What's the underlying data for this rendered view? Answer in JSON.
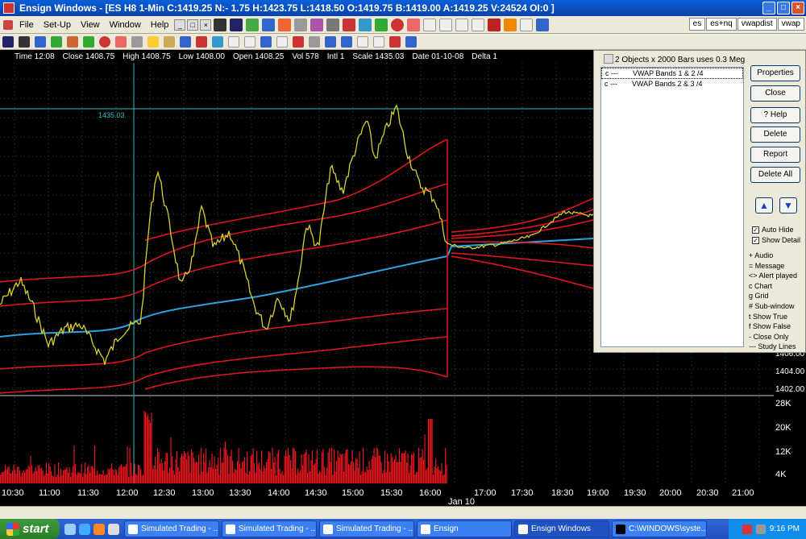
{
  "window": {
    "title": "Ensign Windows - [ES H8 1-Min C:1419.25 N:- 1.75 H:1423.75 L:1418.50 O:1419.75 B:1419.00 A:1419.25 V:24524 OI:0 ]",
    "min_icon": "minimize-icon",
    "max_icon": "maximize-icon",
    "close_icon": "close-icon"
  },
  "menu": {
    "items": [
      "File",
      "Set-Up",
      "View",
      "Window",
      "Help"
    ],
    "tabs": [
      "es",
      "es+nq",
      "vwapdist",
      "vwap"
    ]
  },
  "infobar": {
    "time": "Time 12:08",
    "close": "Close 1408.75",
    "high": "High 1408.75",
    "low": "Low 1408.00",
    "open": "Open 1408.25",
    "vol": "Vol 578",
    "intl": "Intl 1",
    "scale": "Scale 1435.03",
    "date": "Date 01-10-08",
    "delta": "Delta 1"
  },
  "objects_panel": {
    "header": "2 Objects x 2000 Bars uses 0.3 Meg",
    "rows": [
      {
        "flags": "c ---",
        "name": "VWAP Bands   1 & 2 /4"
      },
      {
        "flags": "c ---",
        "name": "VWAP Bands   2 & 3 /4"
      }
    ],
    "buttons": {
      "properties": "Properties",
      "close": "Close",
      "help": "? Help",
      "delete": "Delete",
      "report": "Report",
      "delete_all": "Delete All"
    },
    "auto_hide": "Auto Hide",
    "show_detail": "Show Detail",
    "auto_hide_checked": true,
    "show_detail_checked": true,
    "legend": [
      "+  Audio",
      "=  Message",
      "<> Alert played",
      "c  Chart",
      "g  Grid",
      "#  Sub-window",
      "t  Show True",
      "f  Show False",
      "-  Close Only",
      "--- Study Lines"
    ]
  },
  "chart_data": {
    "type": "line",
    "crosshair_value": "1435.03",
    "price_axis_labels": [
      "1406.00",
      "1404.00",
      "1402.00"
    ],
    "volume_axis_labels": [
      "28K",
      "20K",
      "12K",
      "4K"
    ],
    "time_labels": [
      "10:30",
      "11:00",
      "11:30",
      "12:00",
      "12:30",
      "13:00",
      "13:30",
      "14:00",
      "14:30",
      "15:00",
      "15:30",
      "16:00",
      "17:00",
      "17:30",
      "18:30",
      "19:00",
      "19:30",
      "20:00",
      "20:30",
      "21:00"
    ],
    "date_label": "Jan 10",
    "colors": {
      "price": "#d8cf2e",
      "vwap": "#29a3e0",
      "bands": "#e8161c",
      "volume": "#e8161c",
      "crosshair": "#2bc0c8",
      "grid": "#444444"
    }
  },
  "taskbar": {
    "start": "start",
    "tasks": [
      "Simulated Trading - ...",
      "Simulated Trading - ...",
      "Simulated Trading - ...",
      "Ensign",
      "Ensign Windows",
      "C:\\WINDOWS\\syste..."
    ],
    "active_index": 4,
    "clock": "9:16 PM"
  }
}
